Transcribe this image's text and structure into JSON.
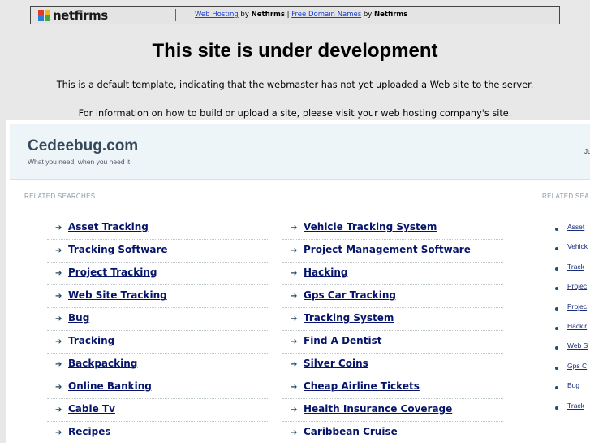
{
  "netfirms_bar": {
    "logo_text": "netfirms",
    "link_web_hosting": "Web Hosting",
    "by1": " by ",
    "brand1": "Netfirms",
    "pipe": " | ",
    "link_free_domains": "Free Domain Names",
    "by2": " by ",
    "brand2": "Netfirms"
  },
  "heading": "This site is under development",
  "message_1": "This is a default template, indicating that the webmaster has not yet uploaded a Web site to the server.",
  "message_2": "For information on how to build or upload a site, please visit your web hosting company's site.",
  "parked": {
    "site_name": "Cedeebug.com",
    "tagline": "What you need, when you need it",
    "header_right": "Ju",
    "related_title_left": "RELATED SEARCHES",
    "related_title_right": "RELATED SEA",
    "col1": [
      "Asset Tracking",
      "Tracking Software",
      "Project Tracking",
      "Web Site Tracking",
      "Bug",
      "Tracking",
      "Backpacking",
      "Online Banking",
      "Cable Tv",
      "Recipes"
    ],
    "col2": [
      "Vehicle Tracking System",
      "Project Management Software",
      "Hacking",
      "Gps Car Tracking",
      "Tracking System",
      "Find A Dentist",
      "Silver Coins",
      "Cheap Airline Tickets",
      "Health Insurance Coverage",
      "Caribbean Cruise"
    ],
    "right_col": [
      "Asset",
      "Vehick",
      "Track",
      "Projec",
      "Projec",
      "Hackir",
      "Web S",
      "Gps C",
      "Bug",
      "Track"
    ]
  },
  "colors": {
    "background": "#e8e8e8",
    "link": "#06156b",
    "header_bg": "#eef5f9",
    "site_name": "#34495a"
  },
  "icons": {
    "list_arrow": "arrow-right-icon",
    "right_list_bullet": "bullet-dot-icon",
    "logo_mark": "netfirms-flag-icon"
  }
}
